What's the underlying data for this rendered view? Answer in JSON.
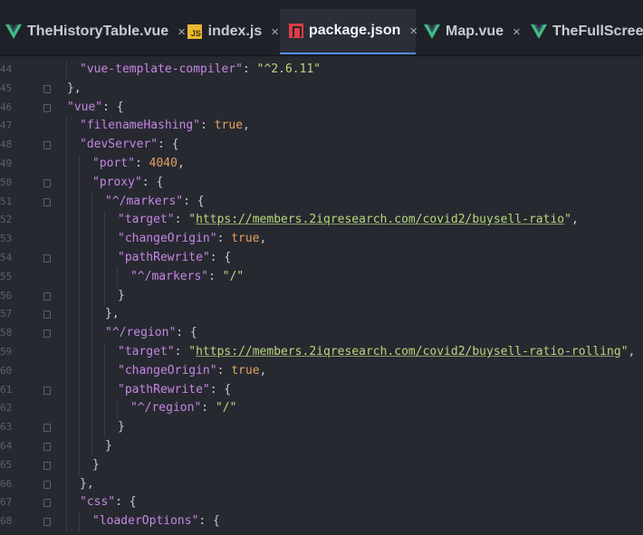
{
  "tabs": [
    {
      "label": "TheHistoryTable.vue",
      "icon": "vue-icon",
      "close": "×",
      "active": false
    },
    {
      "label": "index.js",
      "icon": "js-icon",
      "close": "×",
      "active": false
    },
    {
      "label": "package.json",
      "icon": "npm-icon",
      "close": "×",
      "active": true
    },
    {
      "label": "Map.vue",
      "icon": "vue-icon",
      "close": "×",
      "active": false
    },
    {
      "label": "TheFullScreenD",
      "icon": "vue-icon",
      "close": "",
      "active": false
    }
  ],
  "lines": [
    {
      "num": "44",
      "indent": 1,
      "fold": false,
      "tokens": [
        [
          "k",
          "\"vue-template-compiler\""
        ],
        [
          "p",
          ": "
        ],
        [
          "s",
          "\"^2.6.11\""
        ]
      ]
    },
    {
      "num": "45",
      "indent": 0,
      "fold": true,
      "tokens": [
        [
          "p",
          "},"
        ]
      ]
    },
    {
      "num": "46",
      "indent": 0,
      "fold": true,
      "tokens": [
        [
          "k",
          "\"vue\""
        ],
        [
          "p",
          ": {"
        ]
      ]
    },
    {
      "num": "47",
      "indent": 1,
      "fold": false,
      "tokens": [
        [
          "k",
          "\"filenameHashing\""
        ],
        [
          "p",
          ": "
        ],
        [
          "b",
          "true"
        ],
        [
          "p",
          ","
        ]
      ]
    },
    {
      "num": "48",
      "indent": 1,
      "fold": true,
      "tokens": [
        [
          "k",
          "\"devServer\""
        ],
        [
          "p",
          ": {"
        ]
      ]
    },
    {
      "num": "49",
      "indent": 2,
      "fold": false,
      "tokens": [
        [
          "k",
          "\"port\""
        ],
        [
          "p",
          ": "
        ],
        [
          "n",
          "4040"
        ],
        [
          "p",
          ","
        ]
      ]
    },
    {
      "num": "50",
      "indent": 2,
      "fold": true,
      "tokens": [
        [
          "k",
          "\"proxy\""
        ],
        [
          "p",
          ": {"
        ]
      ]
    },
    {
      "num": "51",
      "indent": 3,
      "fold": true,
      "tokens": [
        [
          "k",
          "\"^/markers\""
        ],
        [
          "p",
          ": {"
        ]
      ]
    },
    {
      "num": "52",
      "indent": 4,
      "fold": false,
      "tokens": [
        [
          "k",
          "\"target\""
        ],
        [
          "p",
          ": "
        ],
        [
          "s",
          "\""
        ],
        [
          "u",
          "https://members.2iqresearch.com/covid2/buysell-ratio"
        ],
        [
          "s",
          "\""
        ],
        [
          "p",
          ","
        ]
      ]
    },
    {
      "num": "53",
      "indent": 4,
      "fold": false,
      "tokens": [
        [
          "k",
          "\"changeOrigin\""
        ],
        [
          "p",
          ": "
        ],
        [
          "b",
          "true"
        ],
        [
          "p",
          ","
        ]
      ]
    },
    {
      "num": "54",
      "indent": 4,
      "fold": true,
      "tokens": [
        [
          "k",
          "\"pathRewrite\""
        ],
        [
          "p",
          ": {"
        ]
      ]
    },
    {
      "num": "55",
      "indent": 5,
      "fold": false,
      "tokens": [
        [
          "k",
          "\"^/markers\""
        ],
        [
          "p",
          ": "
        ],
        [
          "s",
          "\"/\""
        ]
      ]
    },
    {
      "num": "56",
      "indent": 4,
      "fold": true,
      "tokens": [
        [
          "p",
          "}"
        ]
      ]
    },
    {
      "num": "57",
      "indent": 3,
      "fold": true,
      "tokens": [
        [
          "p",
          "},"
        ]
      ]
    },
    {
      "num": "58",
      "indent": 3,
      "fold": true,
      "tokens": [
        [
          "k",
          "\"^/region\""
        ],
        [
          "p",
          ": {"
        ]
      ]
    },
    {
      "num": "59",
      "indent": 4,
      "fold": false,
      "tokens": [
        [
          "k",
          "\"target\""
        ],
        [
          "p",
          ": "
        ],
        [
          "s",
          "\""
        ],
        [
          "u",
          "https://members.2iqresearch.com/covid2/buysell-ratio-rolling"
        ],
        [
          "s",
          "\""
        ],
        [
          "p",
          ","
        ]
      ]
    },
    {
      "num": "60",
      "indent": 4,
      "fold": false,
      "tokens": [
        [
          "k",
          "\"changeOrigin\""
        ],
        [
          "p",
          ": "
        ],
        [
          "b",
          "true"
        ],
        [
          "p",
          ","
        ]
      ]
    },
    {
      "num": "61",
      "indent": 4,
      "fold": true,
      "tokens": [
        [
          "k",
          "\"pathRewrite\""
        ],
        [
          "p",
          ": {"
        ]
      ]
    },
    {
      "num": "62",
      "indent": 5,
      "fold": false,
      "tokens": [
        [
          "k",
          "\"^/region\""
        ],
        [
          "p",
          ": "
        ],
        [
          "s",
          "\"/\""
        ]
      ]
    },
    {
      "num": "63",
      "indent": 4,
      "fold": true,
      "tokens": [
        [
          "p",
          "}"
        ]
      ]
    },
    {
      "num": "64",
      "indent": 3,
      "fold": true,
      "tokens": [
        [
          "p",
          "}"
        ]
      ]
    },
    {
      "num": "65",
      "indent": 2,
      "fold": true,
      "tokens": [
        [
          "p",
          "}"
        ]
      ]
    },
    {
      "num": "66",
      "indent": 1,
      "fold": true,
      "tokens": [
        [
          "p",
          "},"
        ]
      ]
    },
    {
      "num": "67",
      "indent": 1,
      "fold": true,
      "tokens": [
        [
          "k",
          "\"css\""
        ],
        [
          "p",
          ": {"
        ]
      ]
    },
    {
      "num": "68",
      "indent": 2,
      "fold": true,
      "tokens": [
        [
          "k",
          "\"loaderOptions\""
        ],
        [
          "p",
          ": {"
        ]
      ]
    }
  ],
  "colors": {
    "accent": "#4f8edc",
    "vue_green": "#41b883",
    "js_yellow": "#e9b831",
    "npm_red": "#e03d45"
  }
}
